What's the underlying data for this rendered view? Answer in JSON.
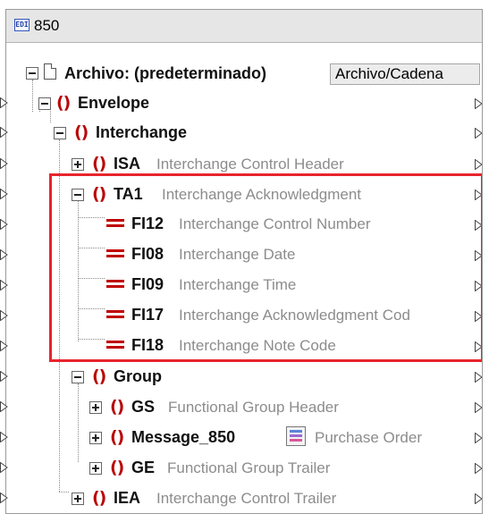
{
  "component": {
    "title": "850",
    "icon": "edi-icon"
  },
  "root": {
    "label": "Archivo: (predeterminado)",
    "button_label": "Archivo/Cadena"
  },
  "envelope": {
    "name": "Envelope"
  },
  "interchange": {
    "name": "Interchange"
  },
  "isa": {
    "name": "ISA",
    "desc": "Interchange Control Header"
  },
  "ta1": {
    "name": "TA1",
    "desc": "Interchange Acknowledgment",
    "fields": [
      {
        "name": "FI12",
        "desc": "Interchange Control Number"
      },
      {
        "name": "FI08",
        "desc": "Interchange Date"
      },
      {
        "name": "FI09",
        "desc": "Interchange Time"
      },
      {
        "name": "FI17",
        "desc": "Interchange Acknowledgment Cod"
      },
      {
        "name": "FI18",
        "desc": "Interchange Note Code"
      }
    ]
  },
  "group": {
    "name": "Group"
  },
  "gs": {
    "name": "GS",
    "desc": "Functional Group Header"
  },
  "message": {
    "name": "Message_850",
    "desc": "Purchase Order",
    "icon": "message-list-icon"
  },
  "ge": {
    "name": "GE",
    "desc": "Functional Group Trailer"
  },
  "iea": {
    "name": "IEA",
    "desc": "Interchange Control Trailer"
  },
  "colors": {
    "element_icon": "#b80808",
    "attribute_icon": "#c00000",
    "description_text": "#8c8c8c",
    "highlight_border": "#e8242c",
    "title_bar": "#e6e6e6"
  }
}
